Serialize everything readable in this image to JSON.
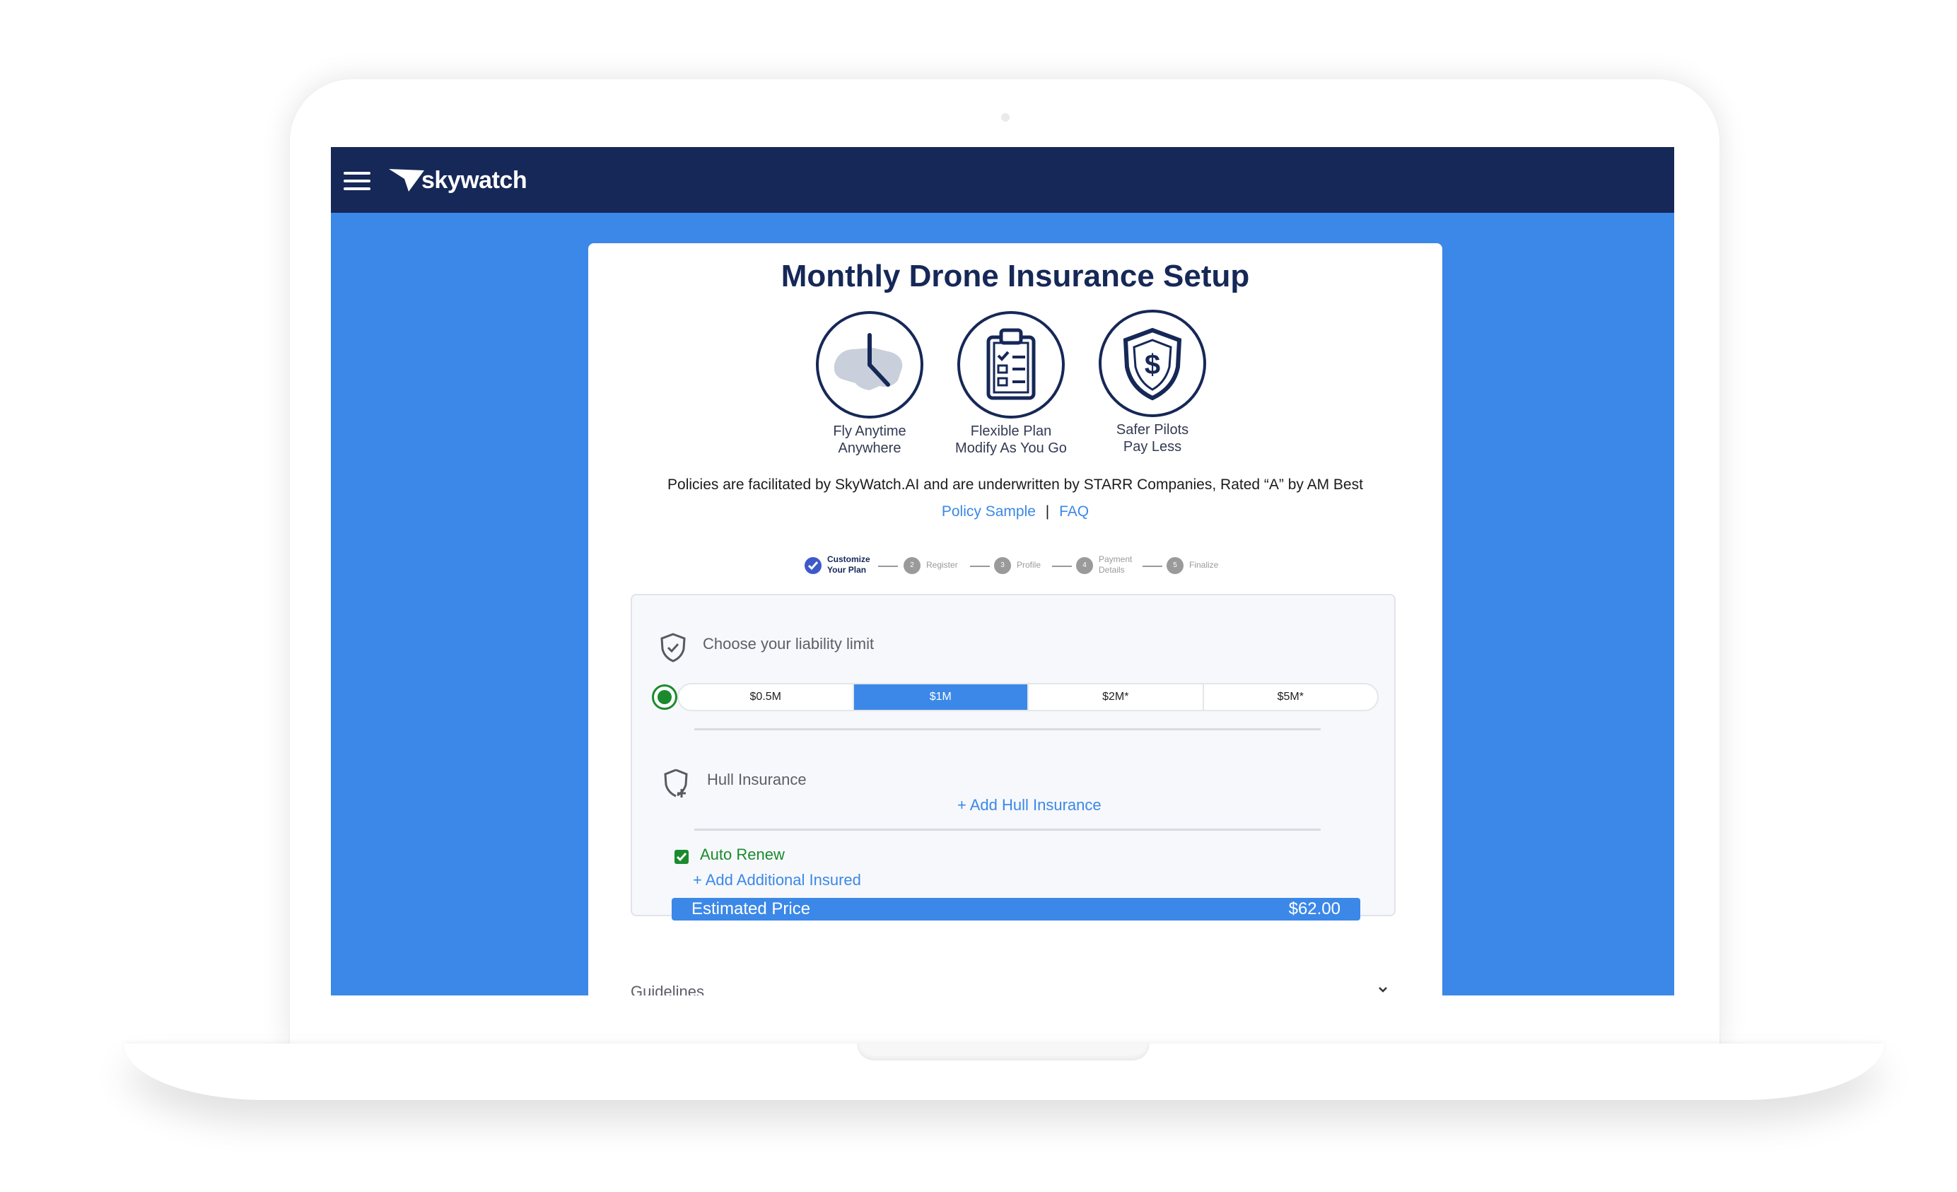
{
  "nav": {
    "logo_text": "skywatch"
  },
  "page": {
    "title": "Monthly Drone Insurance Setup"
  },
  "features": [
    {
      "line1": "Fly Anytime",
      "line2": "Anywhere",
      "icon": "clock-map-icon"
    },
    {
      "line1": "Flexible Plan",
      "line2": "Modify As You Go",
      "icon": "clipboard-checklist-icon"
    },
    {
      "line1": "Safer Pilots",
      "line2": "Pay Less",
      "icon": "shield-dollar-icon"
    }
  ],
  "policy": {
    "text": "Policies are facilitated by SkyWatch.AI and are underwritten by STARR Companies, Rated “A” by AM Best",
    "sample_link": "Policy Sample",
    "separator": "|",
    "faq_link": "FAQ"
  },
  "stepper": {
    "steps": [
      {
        "number": "1",
        "line1": "Customize",
        "line2": "Your Plan"
      },
      {
        "number": "2",
        "line1": "Register",
        "line2": ""
      },
      {
        "number": "3",
        "line1": "Profile",
        "line2": ""
      },
      {
        "number": "4",
        "line1": "Payment",
        "line2": "Details"
      },
      {
        "number": "5",
        "line1": "Finalize",
        "line2": ""
      }
    ],
    "active_step": 1
  },
  "liability": {
    "label": "Choose your liability limit",
    "options": [
      "$0.5M",
      "$1M",
      "$2M*",
      "$5M*"
    ],
    "selected": "$1M"
  },
  "hull": {
    "label": "Hull Insurance",
    "add_link": "+ Add Hull Insurance"
  },
  "auto_renew": {
    "label": "Auto Renew",
    "checked": true
  },
  "additional_insured": {
    "add_link": "+ Add Additional Insured"
  },
  "price": {
    "label": "Estimated Price",
    "value": "$62.00"
  },
  "guidelines": {
    "label": "Guidelines"
  },
  "colors": {
    "navy": "#162857",
    "blue": "#3b88e8",
    "green": "#1b8a2e"
  }
}
